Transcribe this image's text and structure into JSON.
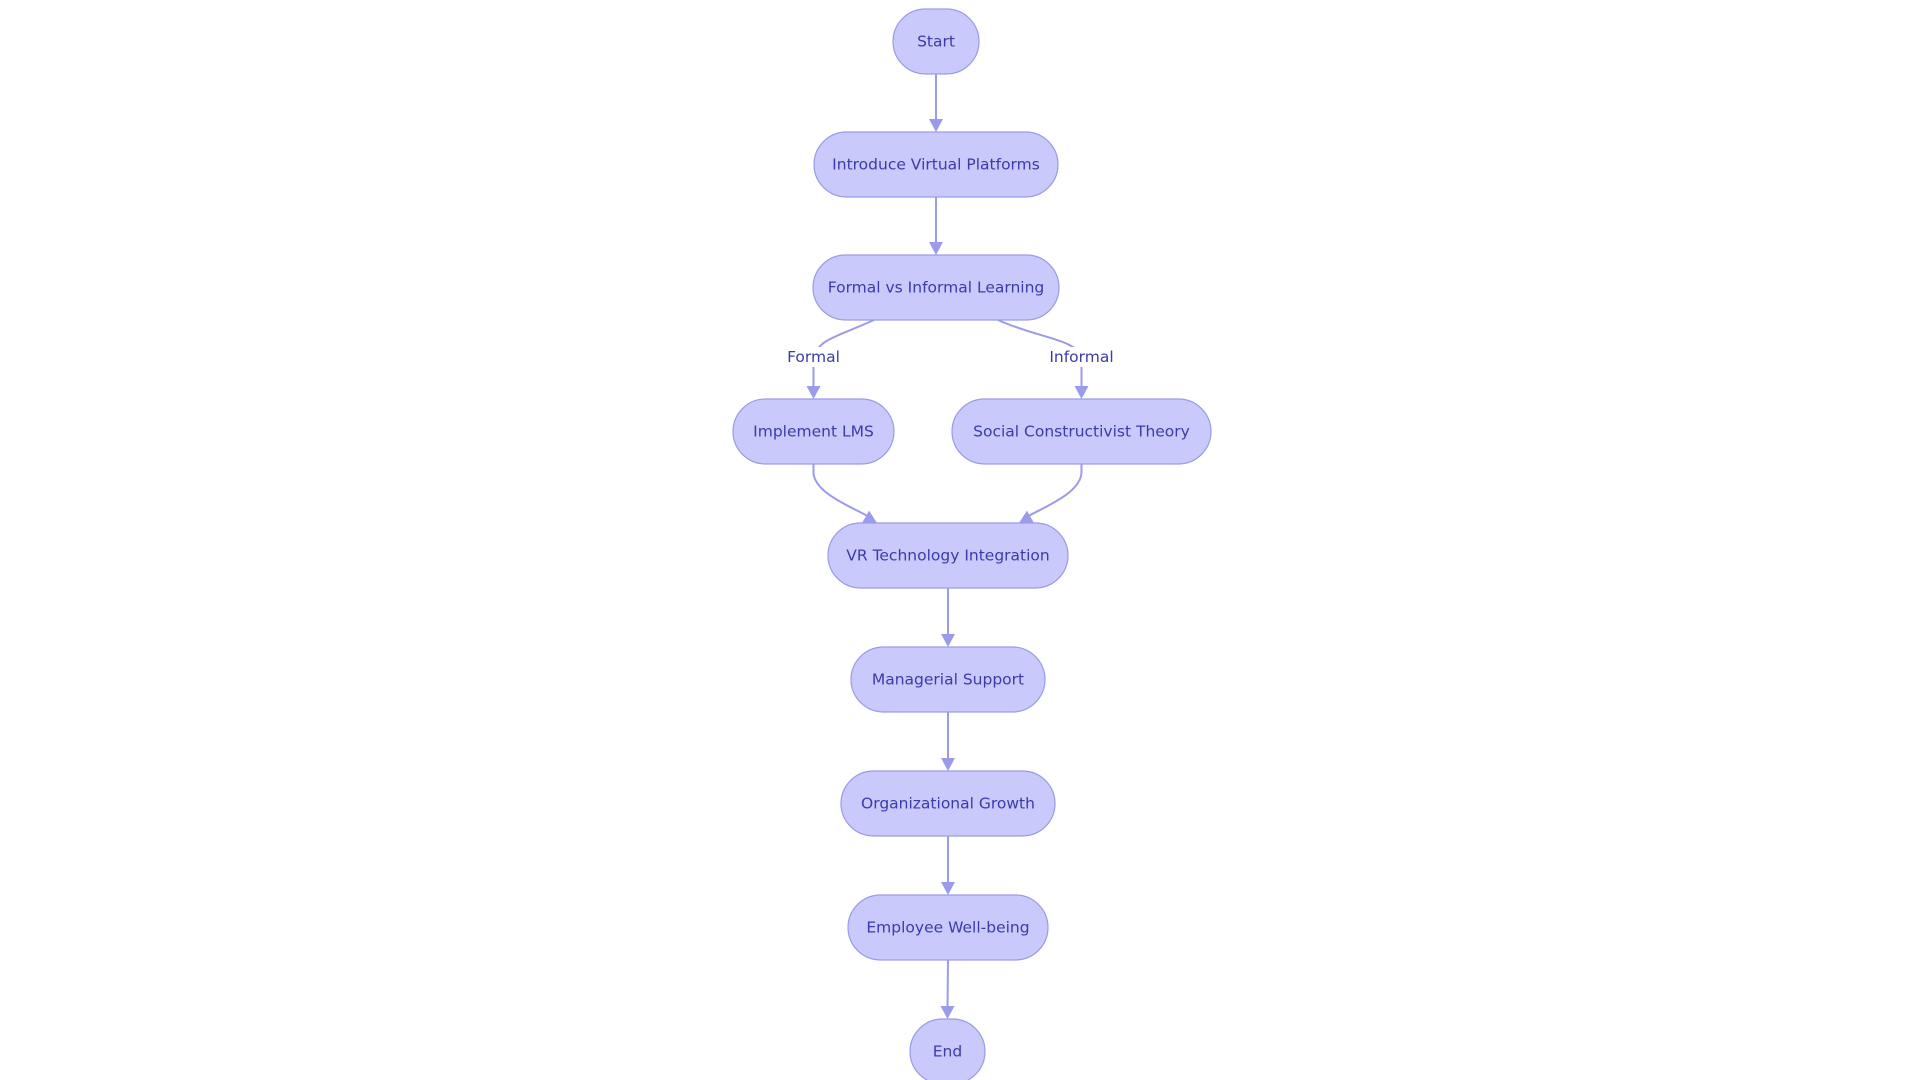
{
  "diagram": {
    "type": "flowchart",
    "direction": "top-down",
    "colors": {
      "node_fill": "#c9c9fb",
      "node_stroke": "#9a9aea",
      "text": "#3b3bab",
      "edge": "#9b9beb"
    },
    "nodes": [
      {
        "id": "start",
        "label": "Start",
        "shape": "stadium"
      },
      {
        "id": "introduce",
        "label": "Introduce Virtual Platforms",
        "shape": "stadium"
      },
      {
        "id": "formal_informal",
        "label": "Formal vs Informal Learning",
        "shape": "stadium"
      },
      {
        "id": "lms",
        "label": "Implement LMS",
        "shape": "stadium"
      },
      {
        "id": "social",
        "label": "Social Constructivist Theory",
        "shape": "stadium"
      },
      {
        "id": "vr",
        "label": "VR Technology Integration",
        "shape": "stadium"
      },
      {
        "id": "managerial",
        "label": "Managerial Support",
        "shape": "stadium"
      },
      {
        "id": "org_growth",
        "label": "Organizational Growth",
        "shape": "stadium"
      },
      {
        "id": "wellbeing",
        "label": "Employee Well-being",
        "shape": "stadium"
      },
      {
        "id": "end",
        "label": "End",
        "shape": "stadium"
      }
    ],
    "edges": [
      {
        "from": "start",
        "to": "introduce",
        "label": ""
      },
      {
        "from": "introduce",
        "to": "formal_informal",
        "label": ""
      },
      {
        "from": "formal_informal",
        "to": "lms",
        "label": "Formal"
      },
      {
        "from": "formal_informal",
        "to": "social",
        "label": "Informal"
      },
      {
        "from": "lms",
        "to": "vr",
        "label": ""
      },
      {
        "from": "social",
        "to": "vr",
        "label": ""
      },
      {
        "from": "vr",
        "to": "managerial",
        "label": ""
      },
      {
        "from": "managerial",
        "to": "org_growth",
        "label": ""
      },
      {
        "from": "org_growth",
        "to": "wellbeing",
        "label": ""
      },
      {
        "from": "wellbeing",
        "to": "end",
        "label": ""
      }
    ]
  }
}
